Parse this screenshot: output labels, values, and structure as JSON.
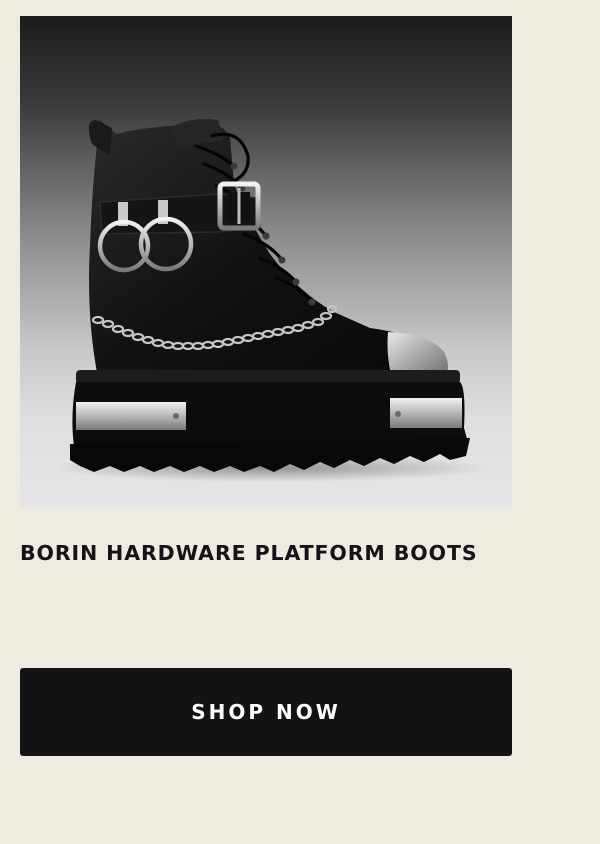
{
  "product": {
    "image_alt": "Black leather platform boot with silver hardware, rings and chain",
    "title": "BORIN HARDWARE PLATFORM BOOTS"
  },
  "cta": {
    "label": "SHOP NOW"
  },
  "colors": {
    "page_background": "#efebe1",
    "button_background": "#131214",
    "button_text": "#ffffff",
    "title_text": "#141315"
  }
}
